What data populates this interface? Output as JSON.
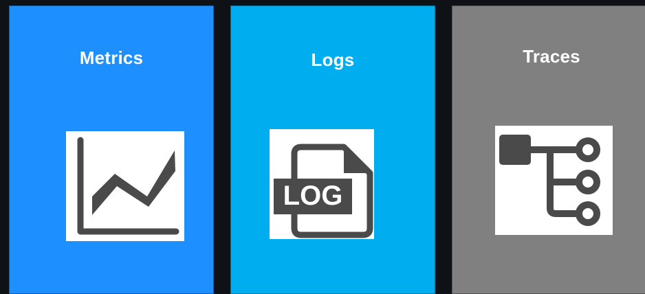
{
  "cards": [
    {
      "title": "Metrics",
      "color": "#1e8fff",
      "icon": "line-chart-icon"
    },
    {
      "title": "Logs",
      "color": "#00aeef",
      "icon": "log-file-icon",
      "icon_text": "LOG"
    },
    {
      "title": "Traces",
      "color": "#808080",
      "icon": "trace-tree-icon"
    }
  ]
}
